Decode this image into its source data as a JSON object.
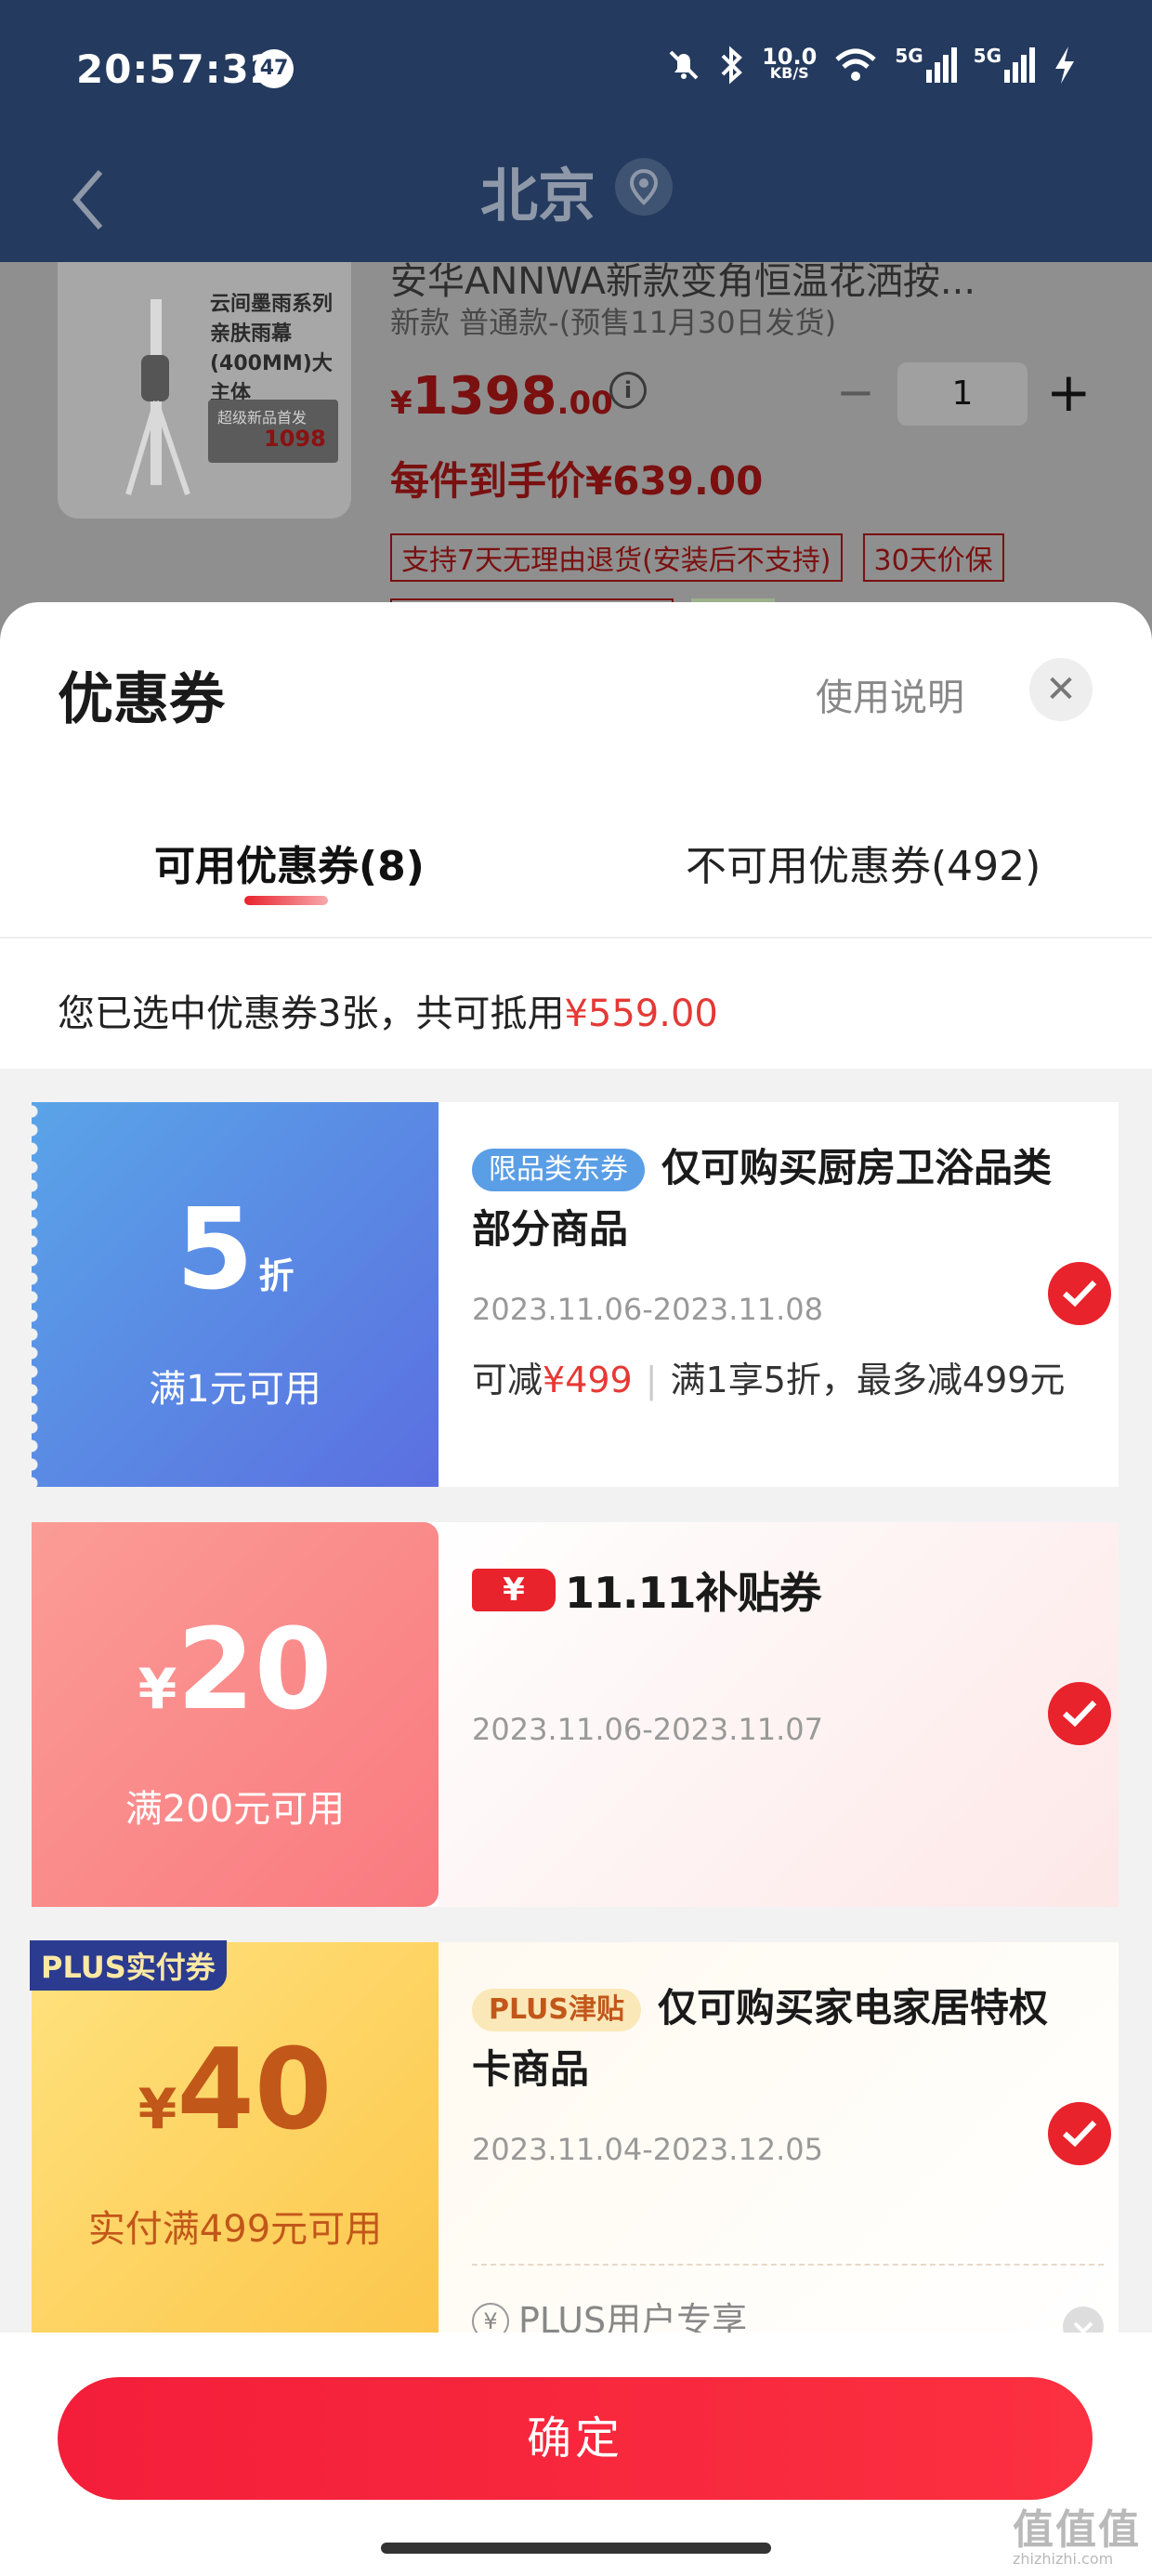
{
  "status_bar": {
    "time": "20:57:32",
    "notification_count": "47",
    "net_speed": "10.0",
    "net_speed_unit": "KB/S",
    "sim1": "5G",
    "sim2": "5G"
  },
  "header": {
    "city": "北京"
  },
  "product": {
    "image_text": "云间墨雨系列\n亲肤雨幕\n(400MM)大主体",
    "image_promo": "超级新品首发",
    "image_price": "1098",
    "title": "安华ANNWA新款变角恒温花洒按...",
    "variant": "新款 普通款-(预售11月30日发货)",
    "price_currency": "¥",
    "price_int": "1398",
    "price_dec": ".00",
    "quantity": "1",
    "final_price": "每件到手价¥639.00",
    "service_tags": [
      "支持7天无理由退货(安装后不支持)",
      "30天价保"
    ]
  },
  "sheet": {
    "title": "优惠券",
    "help_label": "使用说明",
    "tabs": [
      {
        "label": "可用优惠券(8)",
        "active": true
      },
      {
        "label": "不可用优惠券(492)",
        "active": false
      }
    ],
    "summary_prefix": "您已选中优惠券3张，共可抵用",
    "summary_amount": "¥559.00",
    "coupons": [
      {
        "value": "5",
        "unit": "折",
        "min_spend": "满1元可用",
        "tag": "限品类东券",
        "title": "仅可购买厨房卫浴品类部分商品",
        "date": "2023.11.06-2023.11.08",
        "saving_label": "可减",
        "saving_amount": "¥499",
        "rule": "满1享5折，最多减499元",
        "selected": true
      },
      {
        "currency": "¥",
        "value": "20",
        "min_spend": "满200元可用",
        "logo_yen": "¥",
        "logo_text": "11.11补贴券",
        "date": "2023.11.06-2023.11.07",
        "selected": true
      },
      {
        "badge": "PLUS实付券",
        "currency": "¥",
        "value": "40",
        "min_spend": "实付满499元可用",
        "tag": "PLUS津贴",
        "title": "仅可购买家电家居特权卡商品",
        "date": "2023.11.04-2023.12.05",
        "note_icon": "¥",
        "note": "PLUS用户专享",
        "selected": true
      }
    ],
    "confirm_label": "确定"
  },
  "watermark": {
    "text": "值值值",
    "url": "zhizhizhi.com"
  },
  "colors": {
    "header_bg": "#243a5e",
    "accent_red": "#e8232c",
    "coupon_blue": "#5b6fe0",
    "coupon_pink": "#f97a80",
    "coupon_gold": "#fcc64a"
  }
}
